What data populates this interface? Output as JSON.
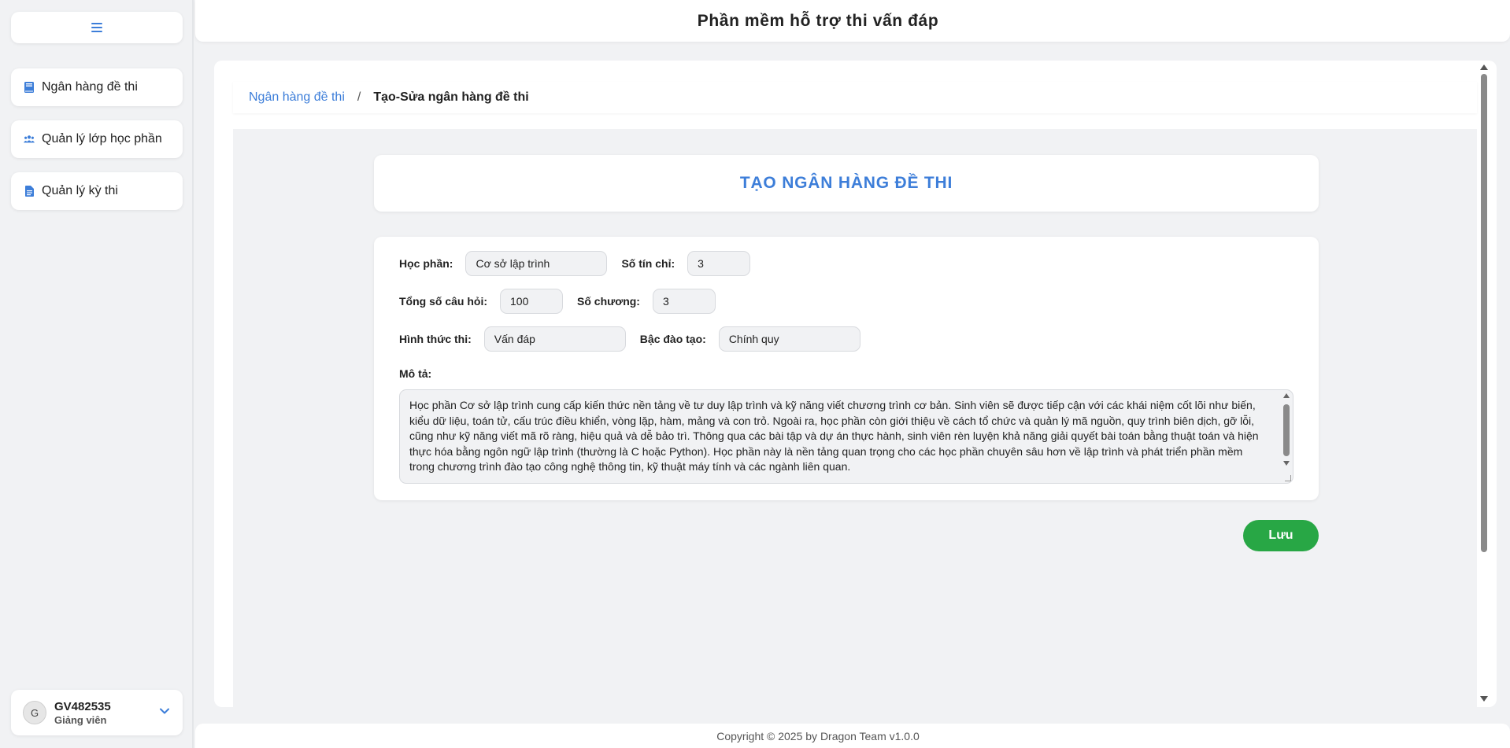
{
  "app": {
    "title": "Phần mềm hỗ trợ thi vấn đáp"
  },
  "sidebar": {
    "toggle_icon": "hamburger-menu-icon",
    "items": [
      {
        "label": "Ngân hàng đề thi",
        "icon": "book-icon"
      },
      {
        "label": "Quản lý lớp học phần",
        "icon": "users-icon"
      },
      {
        "label": "Quản lý kỳ thi",
        "icon": "document-icon"
      }
    ],
    "user": {
      "initial": "G",
      "name": "GV482535",
      "role": "Giảng viên",
      "chevron_icon": "chevron-down-icon"
    }
  },
  "breadcrumb": {
    "parent": "Ngân hàng đề thi",
    "separator": "/",
    "current": "Tạo-Sửa ngân hàng đề thi"
  },
  "page_title": "TẠO NGÂN HÀNG ĐỀ THI",
  "form": {
    "course_label": "Học phần:",
    "course_value": "Cơ sở lập trình",
    "credits_label": "Số tín chỉ:",
    "credits_value": "3",
    "total_questions_label": "Tổng số câu hỏi:",
    "total_questions_value": "100",
    "chapters_label": "Số chương:",
    "chapters_value": "3",
    "exam_type_label": "Hình thức thi:",
    "exam_type_value": "Vấn đáp",
    "training_level_label": "Bậc đào tạo:",
    "training_level_value": "Chính quy",
    "description_label": "Mô tả:",
    "description_value": "Học phần Cơ sở lập trình cung cấp kiến thức nền tảng về tư duy lập trình và kỹ năng viết chương trình cơ bản. Sinh viên sẽ được tiếp cận với các khái niệm cốt lõi như biến, kiểu dữ liệu, toán tử, cấu trúc điều khiển, vòng lặp, hàm, mảng và con trỏ. Ngoài ra, học phần còn giới thiệu về cách tổ chức và quản lý mã nguồn, quy trình biên dịch, gỡ lỗi, cũng như kỹ năng viết mã rõ ràng, hiệu quả và dễ bảo trì. Thông qua các bài tập và dự án thực hành, sinh viên rèn luyện khả năng giải quyết bài toán bằng thuật toán và hiện thực hóa bằng ngôn ngữ lập trình (thường là C hoặc Python). Học phần này là nền tảng quan trọng cho các học phần chuyên sâu hơn về lập trình và phát triển phần mềm trong chương trình đào tạo công nghệ thông tin, kỹ thuật máy tính và các ngành liên quan."
  },
  "actions": {
    "save_label": "Lưu"
  },
  "footer": {
    "copyright": "Copyright © 2025 by Dragon Team v1.0.0"
  },
  "colors": {
    "accent": "#3d7ed9",
    "save": "#28a745",
    "background": "#f1f2f4"
  }
}
